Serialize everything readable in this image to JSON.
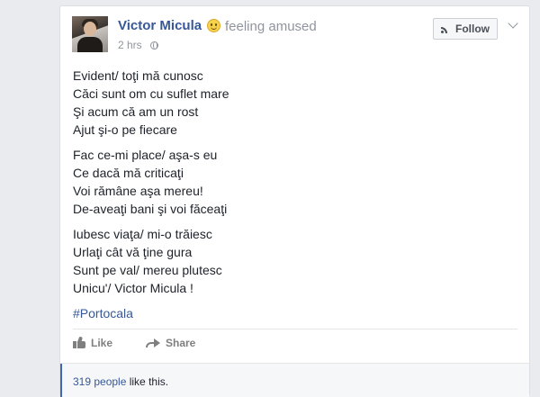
{
  "post": {
    "author": "Victor Micula",
    "feeling": "feeling amused",
    "time": "2 hrs",
    "follow_label": "Follow",
    "stanzas": [
      [
        "Evident/ toţi mă cunosc",
        "Căci sunt om cu suflet mare",
        "Şi acum că am un rost",
        "Ajut şi-o pe fiecare"
      ],
      [
        "Fac ce-mi place/ aşa-s eu",
        "Ce dacă mă criticaţi",
        "Voi rămâne aşa mereu!",
        "De-aveaţi bani şi voi făceaţi"
      ],
      [
        "Iubesc viaţa/ mi-o trăiesc",
        "Urlaţi cât vă ţine gura",
        "Sunt pe val/ mereu plutesc",
        "Unicu'/ Victor Micula !"
      ]
    ],
    "hashtag": "#Portocala"
  },
  "actions": {
    "like_label": "Like",
    "share_label": "Share"
  },
  "likes": {
    "count_label": "319 people",
    "suffix": " like this."
  },
  "icons": [
    "smile-emoji-icon",
    "globe-icon",
    "rss-icon",
    "chevron-down-icon",
    "thumbs-up-icon",
    "share-arrow-icon"
  ],
  "colors": {
    "link": "#365899",
    "accent": "#4267b2"
  }
}
